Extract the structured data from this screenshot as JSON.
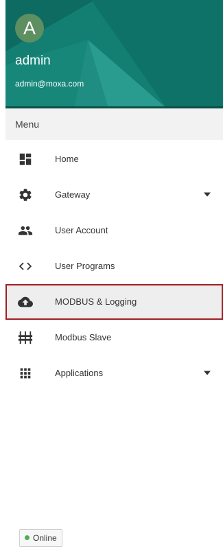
{
  "user": {
    "avatar_initial": "A",
    "name": "admin",
    "email": "admin@moxa.com"
  },
  "menu": {
    "title": "Menu",
    "items": [
      {
        "label": "Home",
        "icon": "dashboard-icon",
        "has_submenu": false,
        "active": false
      },
      {
        "label": "Gateway",
        "icon": "gear-icon",
        "has_submenu": true,
        "active": false
      },
      {
        "label": "User Account",
        "icon": "people-icon",
        "has_submenu": false,
        "active": false
      },
      {
        "label": "User Programs",
        "icon": "code-icon",
        "has_submenu": false,
        "active": false
      },
      {
        "label": "MODBUS & Logging",
        "icon": "cloud-upload-icon",
        "has_submenu": false,
        "active": true
      },
      {
        "label": "Modbus Slave",
        "icon": "equalizer-icon",
        "has_submenu": false,
        "active": false
      },
      {
        "label": "Applications",
        "icon": "apps-grid-icon",
        "has_submenu": true,
        "active": false
      }
    ]
  },
  "status": {
    "label": "Online",
    "color": "#4caf50"
  },
  "colors": {
    "header_bg": "#137f73",
    "active_border": "#a01f24",
    "icon": "#333333"
  }
}
